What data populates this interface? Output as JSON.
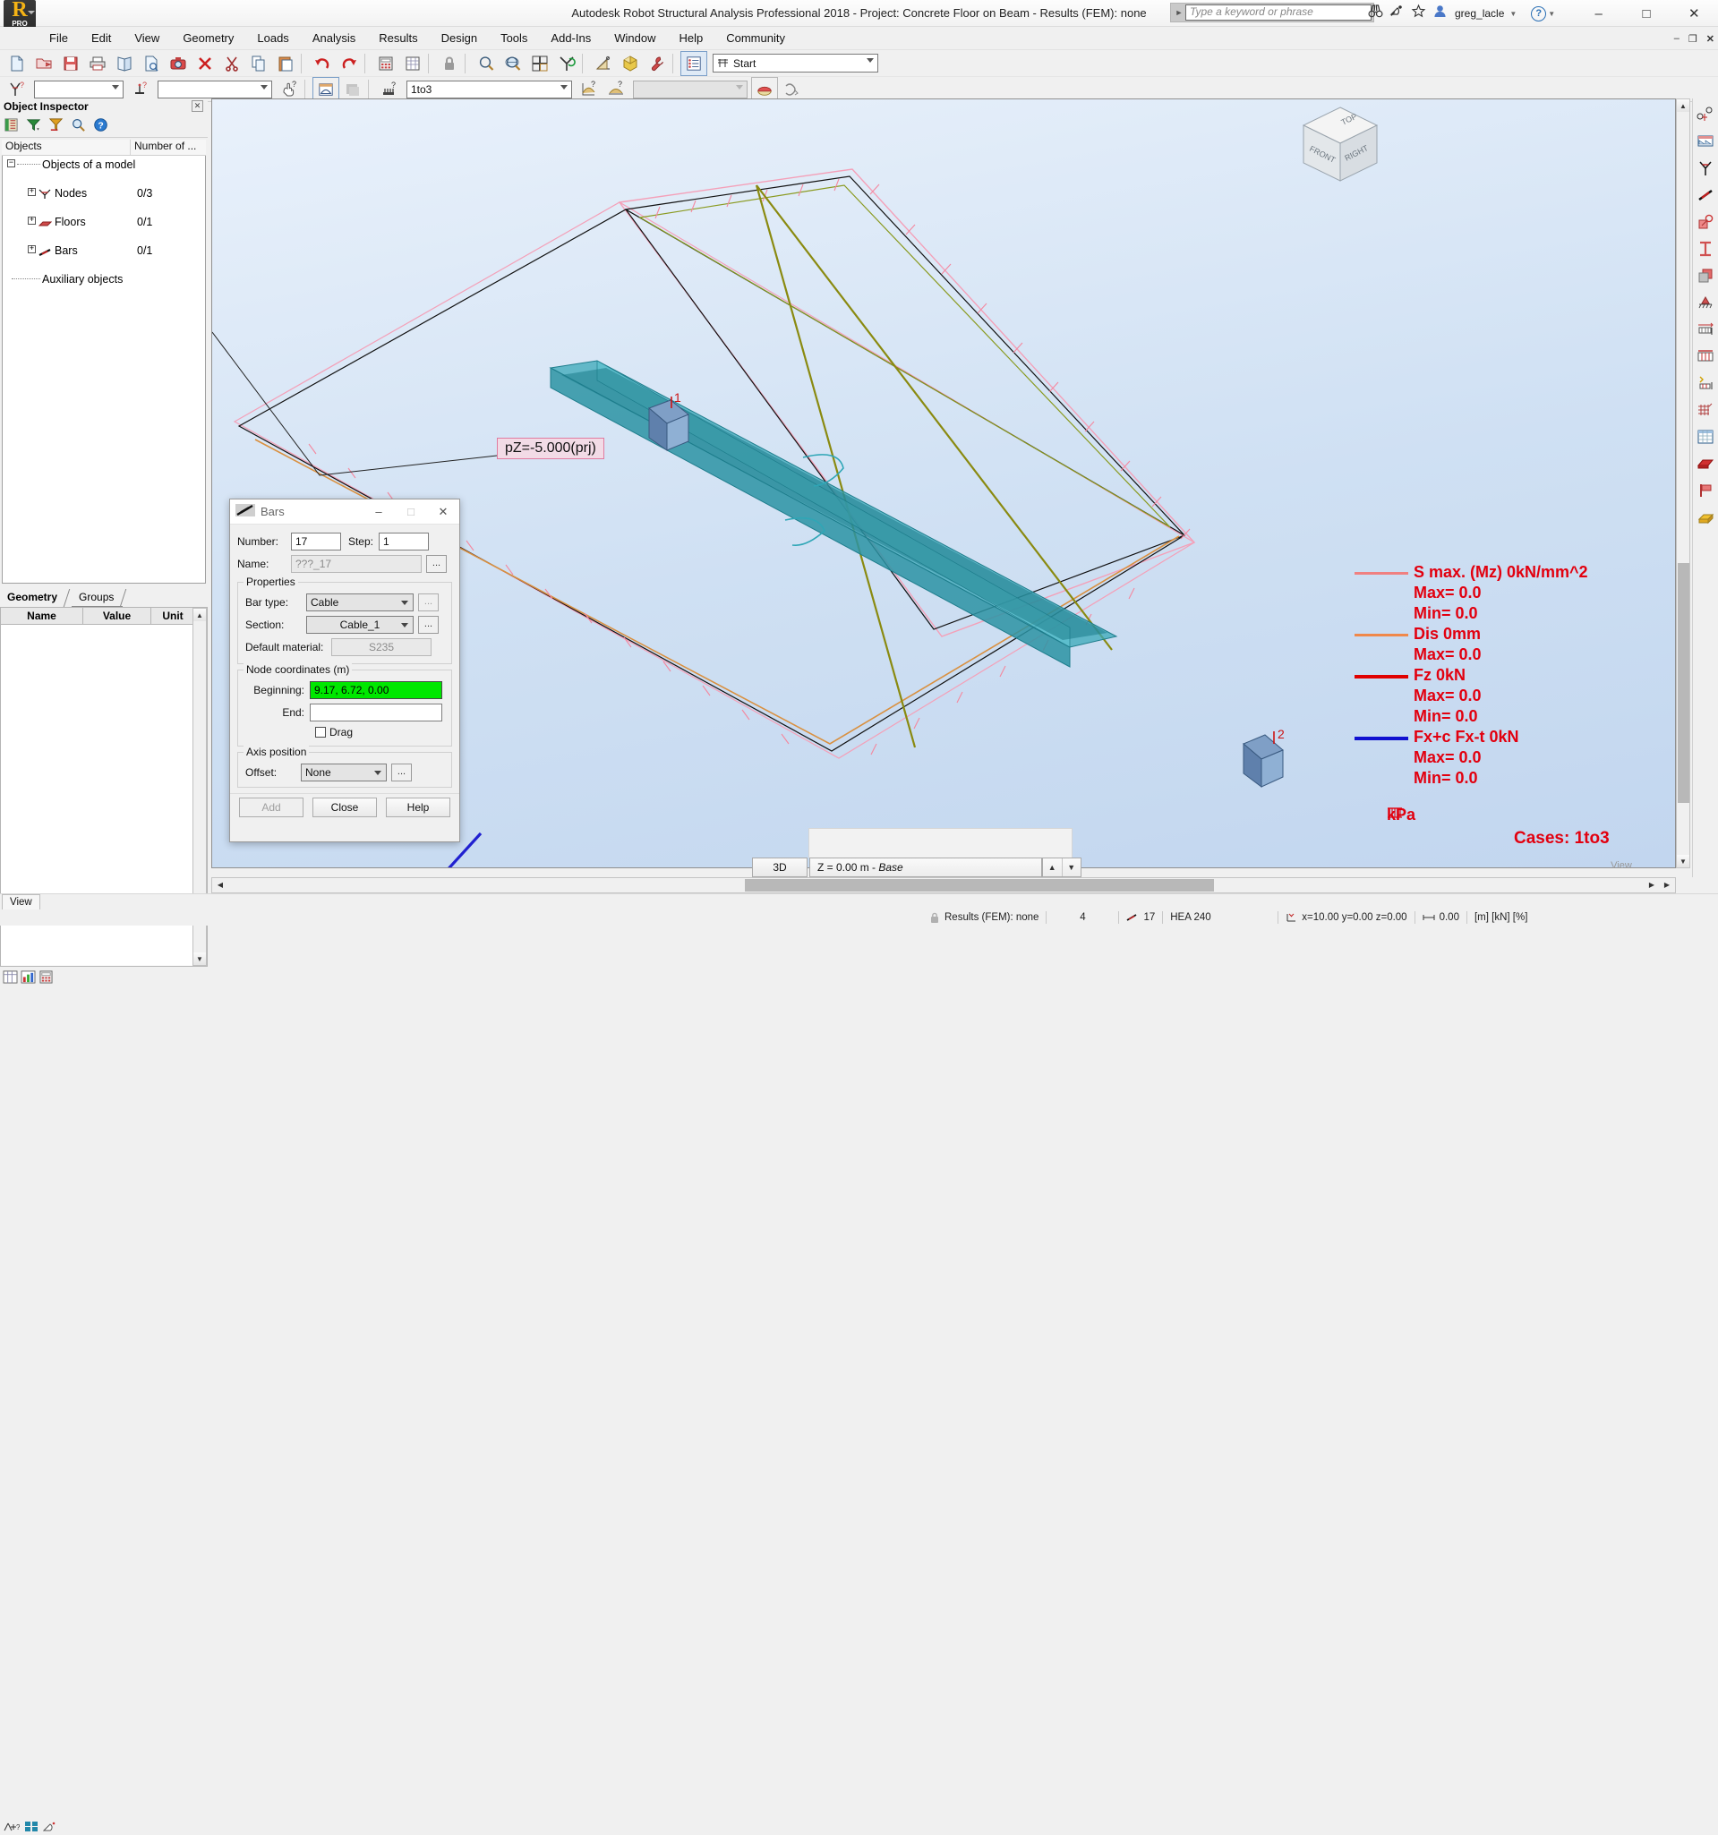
{
  "app": {
    "title": "Autodesk Robot Structural Analysis Professional 2018 - Project: Concrete Floor on Beam - Results (FEM): none",
    "logo_text": "R",
    "logo_sub": "PRO",
    "user": "greg_lacle",
    "search_placeholder": "Type a keyword or phrase"
  },
  "menu": {
    "items": [
      "File",
      "Edit",
      "View",
      "Geometry",
      "Loads",
      "Analysis",
      "Results",
      "Design",
      "Tools",
      "Add-Ins",
      "Window",
      "Help",
      "Community"
    ]
  },
  "toolbar1": {
    "layout_select": "Start",
    "icons": [
      "new-document-icon",
      "open-folder-icon",
      "save-icon",
      "print-icon",
      "print-preview-icon",
      "report-icon",
      "snapshot-camera-icon",
      "delete-x-icon",
      "cut-scissors-icon",
      "copy-icon",
      "paste-icon",
      "undo-icon",
      "redo-icon",
      "calculator-icon",
      "table-icon",
      "lock-icon",
      "zoom-window-icon",
      "zoom-globe-icon",
      "zoom-previous-icon",
      "refresh-axis-icon",
      "dimension-icon",
      "render-icon",
      "wrench-settings-icon",
      "layout-list-icon"
    ]
  },
  "toolbar2": {
    "combo1_value": "",
    "combo2_value": "",
    "case_value": "1to3",
    "combo_disabled_value": "",
    "icons": [
      "node-query-icon",
      "support-query-icon",
      "hand-query-icon",
      "section-view-icon",
      "gray-plate-icon",
      "load-query-icon",
      "diagram-query-icon",
      "support-reaction-icon",
      "map-color-icon",
      "mesh-icon"
    ]
  },
  "object_inspector": {
    "title": "Object Inspector",
    "toolbar_icons": [
      "layers-icon",
      "filter-icon",
      "selection-filter-icon",
      "search-icon",
      "help-icon"
    ],
    "columns": [
      "Objects",
      "Number of ..."
    ],
    "tree": [
      {
        "label": "Objects of a model",
        "count": "",
        "expander": "-",
        "level": 0,
        "icon": ""
      },
      {
        "label": "Nodes",
        "count": "0/3",
        "expander": "+",
        "level": 1,
        "icon": "node-icon"
      },
      {
        "label": "Floors",
        "count": "0/1",
        "expander": "+",
        "level": 1,
        "icon": "floor-icon"
      },
      {
        "label": "Bars",
        "count": "0/1",
        "expander": "+",
        "level": 1,
        "icon": "bar-icon"
      },
      {
        "label": "Auxiliary objects",
        "count": "",
        "expander": "",
        "level": 1,
        "icon": ""
      }
    ],
    "tabs": [
      {
        "label": "Geometry",
        "active": true
      },
      {
        "label": "Groups",
        "active": false
      }
    ],
    "property_columns": [
      "Name",
      "Value",
      "Unit"
    ]
  },
  "viewport": {
    "load_label": "pZ=-5.000(prj)",
    "node_labels": [
      "1",
      "2"
    ],
    "view_cube": {
      "top": "TOP",
      "front": "FRONT",
      "right": "RIGHT"
    },
    "legend": [
      {
        "line_color": "#f08080",
        "text": "S max. (Mz) 0kN/mm^2",
        "max": "Max=    0.0",
        "min": "Min=    0.0"
      },
      {
        "line_color": "#f0884a",
        "text": "Dis  0mm",
        "max": "Max=    0.0",
        "min": ""
      },
      {
        "line_color": "#e00000",
        "text": "Fz  0kN",
        "max": "Max=    0.0",
        "min": "Min=    0.0"
      },
      {
        "line_color": "#1010d0",
        "text": "Fx+c Fx-t  0kN",
        "max": "Max=    0.0",
        "min": "Min=    0.0"
      }
    ],
    "units_label": "kPa",
    "cases_label": "Cases: 1to3",
    "btn_3d": "3D",
    "z_level": "Z = 0.00 m - ",
    "z_level_italic": "Base",
    "view_right_label": "View"
  },
  "bars_dialog": {
    "title": "Bars",
    "number_label": "Number:",
    "number_value": "17",
    "step_label": "Step:",
    "step_value": "1",
    "name_label": "Name:",
    "name_value": "???_17",
    "properties_group": "Properties",
    "bar_type_label": "Bar type:",
    "bar_type_value": "Cable",
    "section_label": "Section:",
    "section_value": "Cable_1",
    "material_label": "Default material:",
    "material_value": "S235",
    "node_coords_group": "Node coordinates (m)",
    "beginning_label": "Beginning:",
    "beginning_value": "9.17, 6.72, 0.00",
    "end_label": "End:",
    "end_value": "",
    "drag_label": "Drag",
    "axis_group": "Axis position",
    "offset_label": "Offset:",
    "offset_value": "None",
    "ellipsis": "...",
    "add_button": "Add",
    "close_button": "Close",
    "help_button": "Help"
  },
  "view_tab": {
    "label": "View"
  },
  "statusbar": {
    "results": "Results (FEM): none",
    "count": "4",
    "bar_count": "17",
    "section": "HEA 240",
    "coords": "x=10.00  y=0.00  z=0.00",
    "value": "0.00",
    "units": "[m] [kN] [%]"
  }
}
